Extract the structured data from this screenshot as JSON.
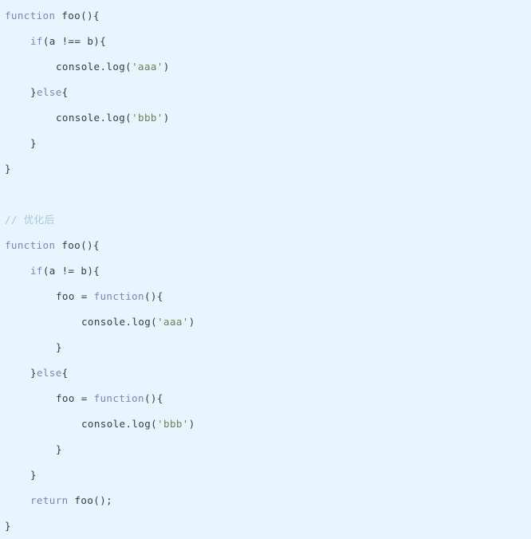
{
  "editor": {
    "background_color": "#e8f5fe",
    "language": "javascript",
    "font_kind": "monospace"
  },
  "palette": {
    "keyword": "#7f7fc4",
    "plain": "#2f3e4e",
    "string": "#6e8055",
    "comment": "#a9c6d9",
    "background": "#e8f5fe"
  },
  "code": {
    "lines": [
      {
        "index": 1,
        "indent": 0,
        "text": "function foo(){",
        "tokens": [
          {
            "t": "function",
            "c": "kw"
          },
          {
            "t": " foo(){",
            "c": "plain"
          }
        ]
      },
      {
        "index": 2,
        "indent": 1,
        "text": "if(a !== b){",
        "tokens": [
          {
            "t": "if",
            "c": "kw"
          },
          {
            "t": "(a !== b){",
            "c": "plain"
          }
        ]
      },
      {
        "index": 3,
        "indent": 2,
        "text": "console.log('aaa')",
        "tokens": [
          {
            "t": "console.log(",
            "c": "plain"
          },
          {
            "t": "'aaa'",
            "c": "str"
          },
          {
            "t": ")",
            "c": "plain"
          }
        ]
      },
      {
        "index": 4,
        "indent": 1,
        "text": "}else{",
        "tokens": [
          {
            "t": "}",
            "c": "plain"
          },
          {
            "t": "else",
            "c": "kw"
          },
          {
            "t": "{",
            "c": "plain"
          }
        ]
      },
      {
        "index": 5,
        "indent": 2,
        "text": "console.log('bbb')",
        "tokens": [
          {
            "t": "console.log(",
            "c": "plain"
          },
          {
            "t": "'bbb'",
            "c": "str"
          },
          {
            "t": ")",
            "c": "plain"
          }
        ]
      },
      {
        "index": 6,
        "indent": 1,
        "text": "}",
        "tokens": [
          {
            "t": "}",
            "c": "plain"
          }
        ]
      },
      {
        "index": 7,
        "indent": 0,
        "text": "}",
        "tokens": [
          {
            "t": "}",
            "c": "plain"
          }
        ]
      },
      {
        "index": 8,
        "indent": 0,
        "text": "",
        "tokens": []
      },
      {
        "index": 9,
        "indent": 0,
        "text": "// 优化后",
        "tokens": [
          {
            "t": "// 优化后",
            "c": "comment"
          }
        ]
      },
      {
        "index": 10,
        "indent": 0,
        "text": "function foo(){",
        "tokens": [
          {
            "t": "function",
            "c": "kw"
          },
          {
            "t": " foo(){",
            "c": "plain"
          }
        ]
      },
      {
        "index": 11,
        "indent": 1,
        "text": "if(a != b){",
        "tokens": [
          {
            "t": "if",
            "c": "kw"
          },
          {
            "t": "(a != b){",
            "c": "plain"
          }
        ]
      },
      {
        "index": 12,
        "indent": 2,
        "text": "foo = function(){",
        "tokens": [
          {
            "t": "foo = ",
            "c": "plain"
          },
          {
            "t": "function",
            "c": "kw"
          },
          {
            "t": "(){",
            "c": "plain"
          }
        ]
      },
      {
        "index": 13,
        "indent": 3,
        "text": "console.log('aaa')",
        "tokens": [
          {
            "t": "console.log(",
            "c": "plain"
          },
          {
            "t": "'aaa'",
            "c": "str"
          },
          {
            "t": ")",
            "c": "plain"
          }
        ]
      },
      {
        "index": 14,
        "indent": 2,
        "text": "}",
        "tokens": [
          {
            "t": "}",
            "c": "plain"
          }
        ]
      },
      {
        "index": 15,
        "indent": 1,
        "text": "}else{",
        "tokens": [
          {
            "t": "}",
            "c": "plain"
          },
          {
            "t": "else",
            "c": "kw"
          },
          {
            "t": "{",
            "c": "plain"
          }
        ]
      },
      {
        "index": 16,
        "indent": 2,
        "text": "foo = function(){",
        "tokens": [
          {
            "t": "foo = ",
            "c": "plain"
          },
          {
            "t": "function",
            "c": "kw"
          },
          {
            "t": "(){",
            "c": "plain"
          }
        ]
      },
      {
        "index": 17,
        "indent": 3,
        "text": "console.log('bbb')",
        "tokens": [
          {
            "t": "console.log(",
            "c": "plain"
          },
          {
            "t": "'bbb'",
            "c": "str"
          },
          {
            "t": ")",
            "c": "plain"
          }
        ]
      },
      {
        "index": 18,
        "indent": 2,
        "text": "}",
        "tokens": [
          {
            "t": "}",
            "c": "plain"
          }
        ]
      },
      {
        "index": 19,
        "indent": 1,
        "text": "}",
        "tokens": [
          {
            "t": "}",
            "c": "plain"
          }
        ]
      },
      {
        "index": 20,
        "indent": 1,
        "text": "return foo();",
        "tokens": [
          {
            "t": "return",
            "c": "kw"
          },
          {
            "t": " foo();",
            "c": "plain"
          }
        ]
      },
      {
        "index": 21,
        "indent": 0,
        "text": "}",
        "tokens": [
          {
            "t": "}",
            "c": "plain"
          }
        ]
      }
    ]
  }
}
